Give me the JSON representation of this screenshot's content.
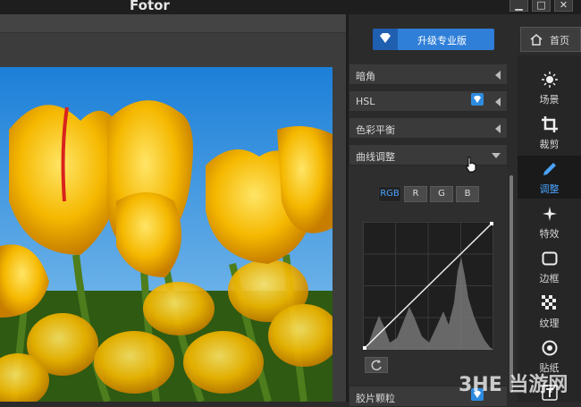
{
  "app": {
    "title": "Fotor"
  },
  "window_controls": {
    "minimize": "▁",
    "maximize": "□",
    "close": "✕"
  },
  "toolbar": {
    "upgrade_label": "升级专业版",
    "home_label": "首页"
  },
  "panels": [
    {
      "label": "暗角",
      "pro": false
    },
    {
      "label": "HSL",
      "pro": true
    },
    {
      "label": "色彩平衡",
      "pro": false
    },
    {
      "label": "曲线调整",
      "pro": false,
      "expanded": true
    },
    {
      "label": "胶片颗粒",
      "pro": true
    }
  ],
  "curves": {
    "channels": [
      "RGB",
      "R",
      "G",
      "B"
    ],
    "selected_channel": "RGB"
  },
  "nav": {
    "items": [
      {
        "label": "场景",
        "icon": "sun-icon"
      },
      {
        "label": "裁剪",
        "icon": "crop-icon"
      },
      {
        "label": "调整",
        "icon": "pencil-icon",
        "active": true
      },
      {
        "label": "特效",
        "icon": "sparkle-icon"
      },
      {
        "label": "边框",
        "icon": "frame-icon"
      },
      {
        "label": "纹理",
        "icon": "texture-icon"
      },
      {
        "label": "贴纸",
        "icon": "target-icon"
      },
      {
        "label": "",
        "icon": "text-icon"
      }
    ]
  },
  "watermark": {
    "text": "3HE 当游网"
  },
  "colors": {
    "accent": "#2f7fd8",
    "active_text": "#4aa3ff",
    "panel_bg": "#3a3a3a"
  }
}
